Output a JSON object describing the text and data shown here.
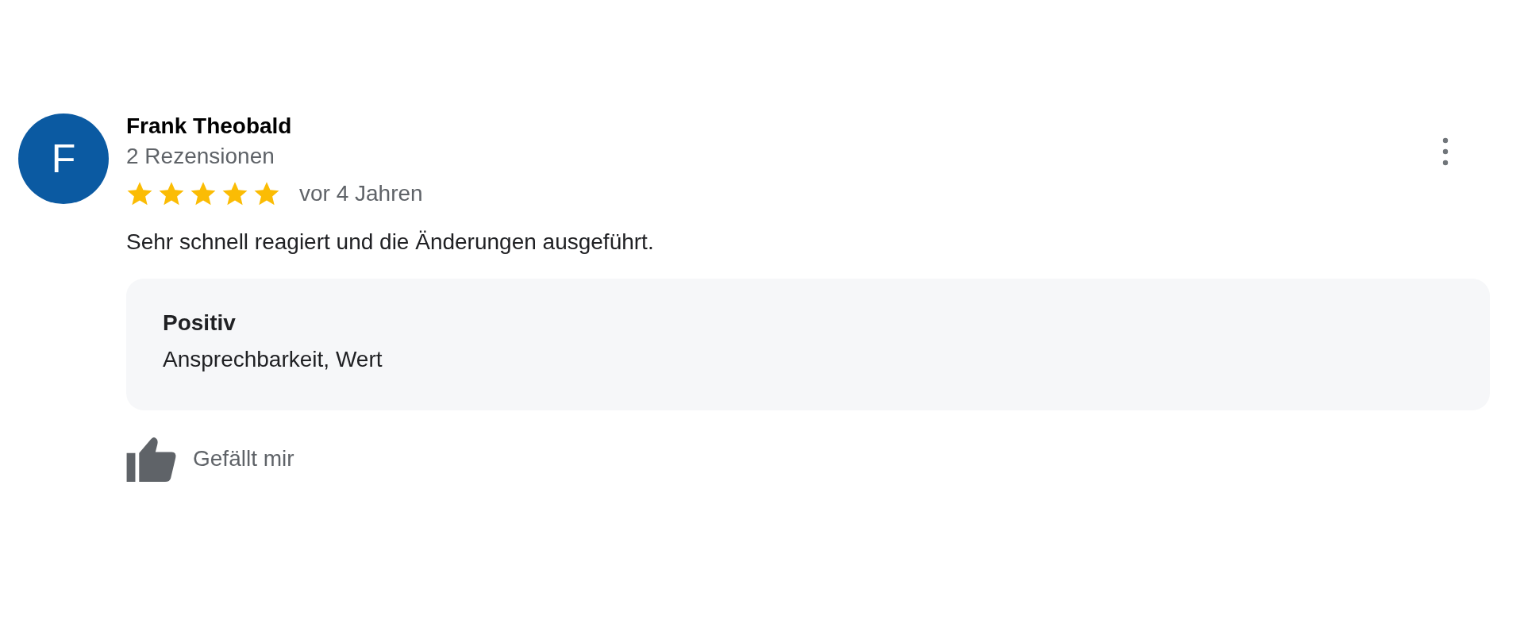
{
  "review": {
    "avatar_letter": "F",
    "author": "Frank Theobald",
    "author_meta": "2 Rezensionen",
    "stars": 5,
    "time": "vor 4 Jahren",
    "text": "Sehr schnell reagiert und die Änderungen ausgeführt.",
    "highlights": [
      {
        "heading": "Positiv",
        "items": "Ansprechbarkeit, Wert"
      }
    ],
    "like_label": "Gefällt mir"
  }
}
